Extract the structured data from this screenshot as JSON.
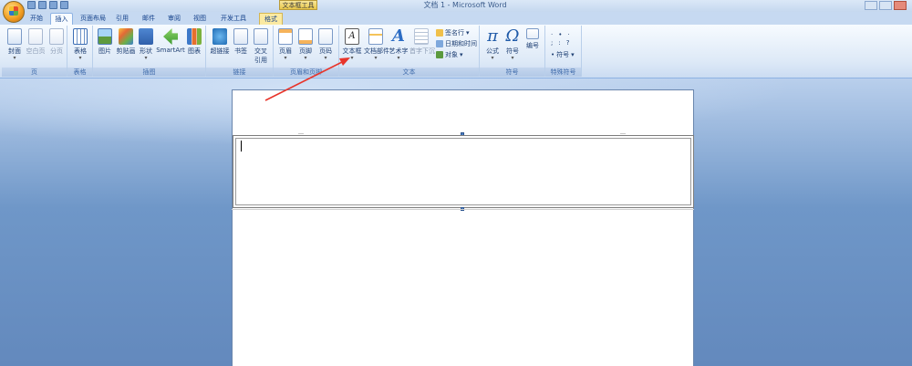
{
  "window": {
    "title": "文档 1 - Microsoft Word",
    "context_tool": "文本框工具"
  },
  "tabs": [
    {
      "label": "开始"
    },
    {
      "label": "插入"
    },
    {
      "label": "页面布局"
    },
    {
      "label": "引用"
    },
    {
      "label": "邮件"
    },
    {
      "label": "审阅"
    },
    {
      "label": "视图"
    },
    {
      "label": "开发工具"
    },
    {
      "label": "格式"
    }
  ],
  "ribbon": {
    "groups": {
      "pages": "页",
      "tables": "表格",
      "illustrations": "插图",
      "links": "链接",
      "header_footer": "页眉和页脚",
      "text": "文本",
      "symbols": "符号",
      "special_symbols": "特殊符号"
    },
    "buttons": {
      "cover": "封面",
      "blank_page": "空白页",
      "page_break": "分页",
      "table": "表格",
      "picture": "图片",
      "clipart": "剪贴画",
      "shapes": "形状",
      "smartart": "SmartArt",
      "chart": "图表",
      "hyperlink": "超链接",
      "bookmark": "书签",
      "cross_ref_1": "交叉",
      "cross_ref_2": "引用",
      "header": "页眉",
      "footer": "页脚",
      "page_number": "页码",
      "textbox": "文本框",
      "quick_parts": "文档部件",
      "wordart": "艺术字",
      "dropcap": "首字下沉",
      "signature_line": "签名行",
      "date_time": "日期和时间",
      "object": "对象",
      "equation": "公式",
      "symbol": "符号",
      "numbering": "编号",
      "special_symbol": "符号"
    },
    "icons": {
      "textbox_glyph": "A",
      "wordart_glyph": "A",
      "equation_glyph": "π",
      "symbol_glyph": "Ω"
    }
  },
  "colors": {
    "arrow": "#e8352b",
    "accent": "#15428b"
  }
}
